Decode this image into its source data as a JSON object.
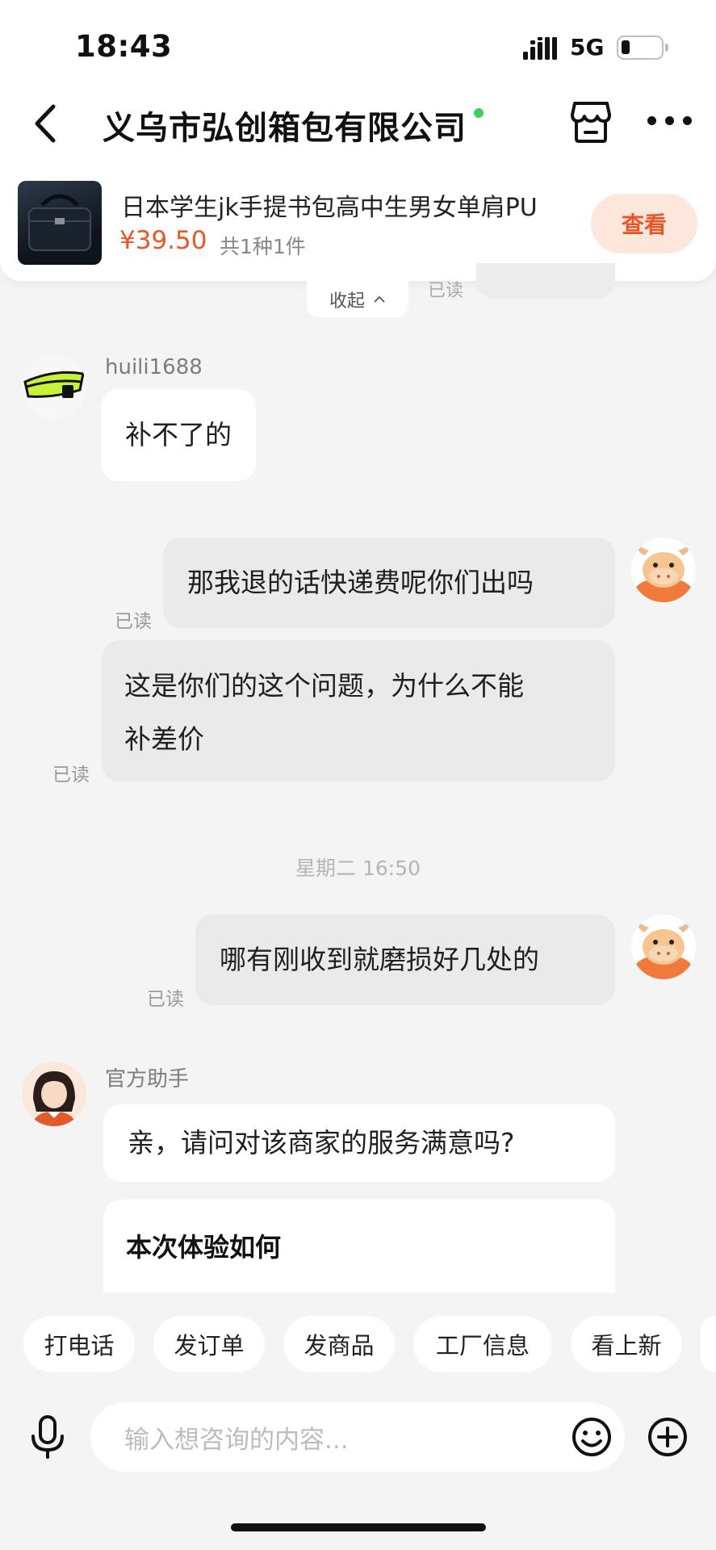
{
  "status_bar": {
    "time": "18:43",
    "network": "5G"
  },
  "header": {
    "title": "义乌市弘创箱包有限公司"
  },
  "product": {
    "title": "日本学生jk手提书包高中生男女单肩PU",
    "price": "¥39.50",
    "quantity": "共1种1件",
    "view_label": "查看"
  },
  "collapse_label": "收起",
  "collapse_read": "已读",
  "messages": [
    {
      "side": "left",
      "sender": "huili1688",
      "text": "补不了的"
    },
    {
      "side": "right",
      "text": "那我退的话快递费呢你们出吗",
      "status": "已读"
    },
    {
      "side": "right",
      "text_line1": "这是你们的这个问题，为什么不能",
      "text_line2": "补差价",
      "status": "已读"
    },
    {
      "side": "right",
      "text": "哪有刚收到就磨损好几处的",
      "status": "已读"
    },
    {
      "side": "left",
      "sender": "官方助手",
      "text": "亲，请问对该商家的服务满意吗?"
    }
  ],
  "timestamp": "星期二 16:50",
  "card": {
    "title": "本次体验如何"
  },
  "quick_actions": [
    "打电话",
    "发订单",
    "发商品",
    "工厂信息",
    "看上新"
  ],
  "input": {
    "placeholder": "输入想咨询的内容..."
  },
  "colors": {
    "accent": "#e8562a",
    "online": "#3ecf5d"
  }
}
